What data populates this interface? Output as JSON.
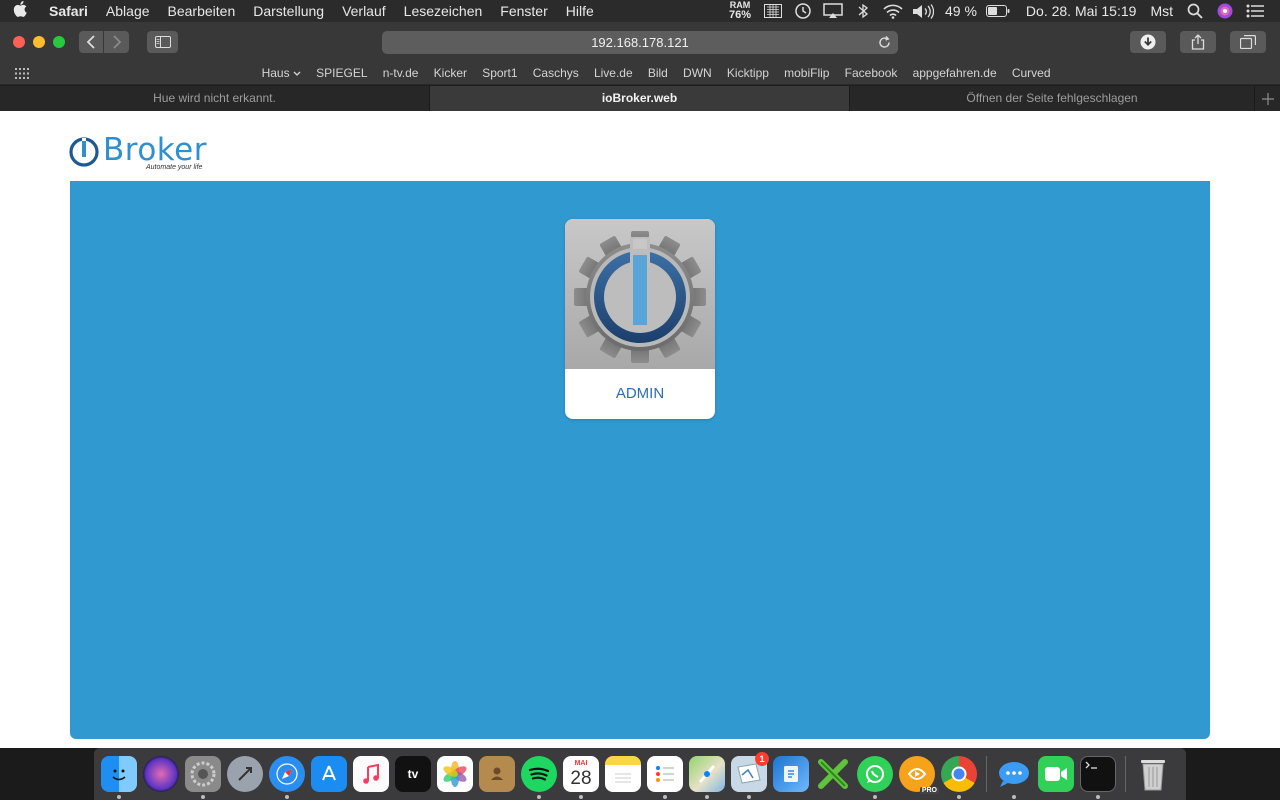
{
  "menubar": {
    "app_name": "Safari",
    "items": [
      "Ablage",
      "Bearbeiten",
      "Darstellung",
      "Verlauf",
      "Lesezeichen",
      "Fenster",
      "Hilfe"
    ],
    "ram_label": "RAM",
    "ram_value": "76%",
    "battery": "49 %",
    "datetime": "Do. 28. Mai  15:19",
    "user": "Mst"
  },
  "toolbar": {
    "url": "192.168.178.121"
  },
  "favorites": [
    "Haus",
    "SPIEGEL",
    "n-tv.de",
    "Kicker",
    "Sport1",
    "Caschys",
    "Live.de",
    "Bild",
    "DWN",
    "Kicktipp",
    "mobiFlip",
    "Facebook",
    "appgefahren.de",
    "Curved"
  ],
  "tabs": [
    {
      "title": "Hue wird nicht erkannt."
    },
    {
      "title": "ioBroker.web"
    },
    {
      "title": "Öffnen der Seite fehlgeschlagen"
    }
  ],
  "page": {
    "logo_text": "Broker",
    "logo_tagline": "Automate your life",
    "tile_label": "ADMIN",
    "panel_color": "#3099d0"
  },
  "dock": {
    "calendar_month": "MAI",
    "calendar_day": "28",
    "mail_badge": "1",
    "infuse_label": "PRO",
    "apps": [
      "finder-icon",
      "siri-icon",
      "system-preferences-icon",
      "launchpad-icon",
      "safari-icon",
      "app-store-icon",
      "music-icon",
      "apple-tv-icon",
      "photos-icon",
      "contacts-icon",
      "spotify-icon",
      "calendar-icon",
      "notes-icon",
      "reminders-icon",
      "maps-icon",
      "mail-icon",
      "ios-app-installer-icon",
      "xmind-icon",
      "whatsapp-icon",
      "infuse-icon",
      "chrome-icon",
      "messages-icon",
      "facetime-icon",
      "terminal-icon",
      "trash-icon"
    ]
  }
}
